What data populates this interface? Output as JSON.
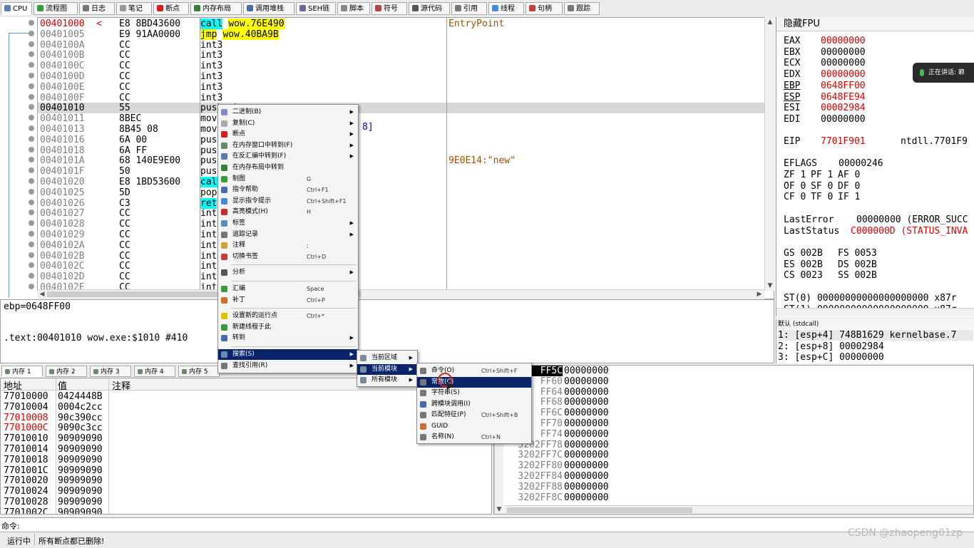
{
  "toolbar": {
    "tabs": [
      {
        "label": "CPU",
        "icon": "cpu-icon",
        "color": "#5a7fb5"
      },
      {
        "label": "流程图",
        "icon": "graph-icon",
        "color": "#3a9a3a"
      },
      {
        "label": "日志",
        "icon": "log-icon",
        "color": "#777777"
      },
      {
        "label": "笔记",
        "icon": "notes-icon",
        "color": "#999999"
      },
      {
        "label": "断点",
        "icon": "breakpoint-icon",
        "color": "#d02020"
      },
      {
        "label": "内存布局",
        "icon": "memory-map-icon",
        "color": "#3a7a3a"
      },
      {
        "label": "调用堆栈",
        "icon": "callstack-icon",
        "color": "#4a6aaa"
      },
      {
        "label": "SEH链",
        "icon": "seh-icon",
        "color": "#6a6a9a"
      },
      {
        "label": "脚本",
        "icon": "script-icon",
        "color": "#888888"
      },
      {
        "label": "符号",
        "icon": "symbol-icon",
        "color": "#b04a4a"
      },
      {
        "label": "源代码",
        "icon": "source-icon",
        "color": "#555555"
      },
      {
        "label": "引用",
        "icon": "references-icon",
        "color": "#777777"
      },
      {
        "label": "线程",
        "icon": "threads-icon",
        "color": "#4a8ad0"
      },
      {
        "label": "句柄",
        "icon": "handles-icon",
        "color": "#c04040"
      },
      {
        "label": "跟踪",
        "icon": "trace-icon",
        "color": "#777777"
      }
    ]
  },
  "disasm": {
    "rows": [
      {
        "addr": "00401000",
        "mark": "<",
        "bytes": "E8 8BD43600",
        "inst": "call",
        "operand": "wow.76E490",
        "comment": "EntryPoint",
        "style": "call",
        "addr_red": true
      },
      {
        "addr": "00401005",
        "mark": "",
        "bytes": "E9 91AA0000",
        "inst": "jmp",
        "operand": "wow.40BA9B",
        "comment": "",
        "style": "jmp"
      },
      {
        "addr": "0040100A",
        "bytes": "CC",
        "inst": "int3",
        "operand": "",
        "comment": ""
      },
      {
        "addr": "0040100B",
        "bytes": "CC",
        "inst": "int3",
        "operand": "",
        "comment": ""
      },
      {
        "addr": "0040100C",
        "bytes": "CC",
        "inst": "int3",
        "operand": "",
        "comment": ""
      },
      {
        "addr": "0040100D",
        "bytes": "CC",
        "inst": "int3",
        "operand": "",
        "comment": ""
      },
      {
        "addr": "0040100E",
        "bytes": "CC",
        "inst": "int3",
        "operand": "",
        "comment": ""
      },
      {
        "addr": "0040100F",
        "bytes": "CC",
        "inst": "int3",
        "operand": "",
        "comment": ""
      },
      {
        "addr": "00401010",
        "bytes": "55",
        "inst": "push ebp",
        "operand": "",
        "comment": "",
        "selected": true
      },
      {
        "addr": "00401011",
        "bytes": "8BEC",
        "inst": "mov",
        "operand": "",
        "comment": ""
      },
      {
        "addr": "00401013",
        "bytes": "8B45 08",
        "inst": "mov",
        "operand": "",
        "comment": ""
      },
      {
        "addr": "00401016",
        "bytes": "6A 00",
        "inst": "push",
        "operand": "",
        "comment": ""
      },
      {
        "addr": "00401018",
        "bytes": "6A FF",
        "inst": "push",
        "operand": "",
        "comment": ""
      },
      {
        "addr": "0040101A",
        "bytes": "68 140E9E00",
        "inst": "push",
        "operand": "",
        "comment": "9E0E14:\"new\""
      },
      {
        "addr": "0040101F",
        "bytes": "50",
        "inst": "push",
        "operand": "",
        "comment": ""
      },
      {
        "addr": "00401020",
        "bytes": "E8 1BD53600",
        "inst": "call",
        "operand": "",
        "comment": "",
        "style": "call"
      },
      {
        "addr": "00401025",
        "bytes": "5D",
        "inst": "pop",
        "operand": "",
        "comment": ""
      },
      {
        "addr": "00401026",
        "bytes": "C3",
        "inst": "ret",
        "operand": "",
        "comment": "",
        "style": "call"
      },
      {
        "addr": "00401027",
        "bytes": "CC",
        "inst": "int",
        "operand": "",
        "comment": ""
      },
      {
        "addr": "00401028",
        "bytes": "CC",
        "inst": "int",
        "operand": "",
        "comment": ""
      },
      {
        "addr": "00401029",
        "bytes": "CC",
        "inst": "int",
        "operand": "",
        "comment": ""
      },
      {
        "addr": "0040102A",
        "bytes": "CC",
        "inst": "int",
        "operand": "",
        "comment": ""
      },
      {
        "addr": "0040102B",
        "bytes": "CC",
        "inst": "int",
        "operand": "",
        "comment": ""
      },
      {
        "addr": "0040102C",
        "bytes": "CC",
        "inst": "int",
        "operand": "",
        "comment": ""
      },
      {
        "addr": "0040102D",
        "bytes": "CC",
        "inst": "int",
        "operand": "",
        "comment": ""
      },
      {
        "addr": "0040102E",
        "bytes": "CC",
        "inst": "int",
        "operand": "",
        "comment": ""
      }
    ],
    "partial_operand": "8]"
  },
  "info": {
    "line1": "ebp=0648FF00",
    "line2": ".text:00401010 wow.exe:$1010 #410"
  },
  "registers": {
    "title": "隐藏FPU",
    "gp": [
      {
        "name": "EAX",
        "value": "00000000",
        "red": true
      },
      {
        "name": "EBX",
        "value": "00000000",
        "red": false
      },
      {
        "name": "ECX",
        "value": "00000000",
        "red": false
      },
      {
        "name": "EDX",
        "value": "00000000",
        "red": true
      },
      {
        "name": "EBP",
        "value": "0648FF00",
        "red": true
      },
      {
        "name": "ESP",
        "value": "0648FE94",
        "red": true
      },
      {
        "name": "ESI",
        "value": "00002984",
        "red": true
      },
      {
        "name": "EDI",
        "value": "00000000",
        "red": false
      }
    ],
    "eip": {
      "name": "EIP",
      "value": "7701F901",
      "label": "ntdll.7701F9"
    },
    "eflags": {
      "name": "EFLAGS",
      "value": "00000246"
    },
    "flags": [
      [
        "ZF 1",
        "PF 1",
        "AF 0"
      ],
      [
        "OF 0",
        "SF 0",
        "DF 0"
      ],
      [
        "CF 0",
        "TF 0",
        "IF 1"
      ]
    ],
    "last_error": {
      "name": "LastError",
      "value": "00000000 (ERROR_SUCC"
    },
    "last_status": {
      "name": "LastStatus",
      "value": "C000000D (STATUS_INVA"
    },
    "segs": [
      [
        "GS 002B",
        "FS 0053"
      ],
      [
        "ES 002B",
        "DS 002B"
      ],
      [
        "CS 0023",
        "SS 002B"
      ]
    ],
    "st": [
      "ST(0) 00000000000000000000 x87r",
      "ST(1) 00000000000000000000 x87r"
    ]
  },
  "args": {
    "convention": "默认 (stdcall)",
    "rows": [
      "1: [esp+4] 748B1629 kernelbase.7",
      "2: [esp+8] 00002984",
      "3: [esp+C] 00000000"
    ]
  },
  "dump": {
    "tabs": [
      "内存 1",
      "内存 2",
      "内存 3",
      "内存 4",
      "内存 5"
    ],
    "headers": {
      "addr": "地址",
      "value": "值",
      "comment": "注释"
    },
    "rows": [
      {
        "addr": "77010000",
        "value": "0424448B",
        "red": false
      },
      {
        "addr": "77010004",
        "value": "0004c2cc",
        "red": false
      },
      {
        "addr": "77010008",
        "value": "90c390cc",
        "red": true
      },
      {
        "addr": "7701000C",
        "value": "9090c3cc",
        "red": true
      },
      {
        "addr": "77010010",
        "value": "90909090",
        "red": false
      },
      {
        "addr": "77010014",
        "value": "90909090",
        "red": false
      },
      {
        "addr": "77010018",
        "value": "90909090",
        "red": false
      },
      {
        "addr": "7701001C",
        "value": "90909090",
        "red": false
      },
      {
        "addr": "77010020",
        "value": "90909090",
        "red": false
      },
      {
        "addr": "77010024",
        "value": "90909090",
        "red": false
      },
      {
        "addr": "77010028",
        "value": "90909090",
        "red": false
      },
      {
        "addr": "7701002C",
        "value": "90909090",
        "red": false
      }
    ]
  },
  "stack": {
    "rows": [
      {
        "addr": "FF5C",
        "value": "00000000",
        "selected": true
      },
      {
        "addr": "FF60",
        "value": "00000000"
      },
      {
        "addr": "FF64",
        "value": "00000000"
      },
      {
        "addr": "FF68",
        "value": "00000000"
      },
      {
        "addr": "FF6C",
        "value": "00000000"
      },
      {
        "addr": "FF70",
        "value": "00000000"
      },
      {
        "addr": "FF74",
        "value": "00000000"
      },
      {
        "addr": "3202FF78",
        "value": "00000000"
      },
      {
        "addr": "3202FF7C",
        "value": "00000000"
      },
      {
        "addr": "3202FF80",
        "value": "00000000"
      },
      {
        "addr": "3202FF84",
        "value": "00000000"
      },
      {
        "addr": "3202FF88",
        "value": "00000000"
      },
      {
        "addr": "3202FF8C",
        "value": "00000000"
      }
    ]
  },
  "command": {
    "label": "命令:"
  },
  "status": {
    "state": "运行中",
    "message": "所有断点都已删除!"
  },
  "toast": {
    "text": "正在讲话: 赖"
  },
  "watermark": "CSDN @zhaopeng01zp",
  "menu_main": {
    "items": [
      {
        "label": "二进制(B)",
        "sc": "",
        "sub": true,
        "icon": "binary-icon",
        "color": "#8888cc"
      },
      {
        "label": "复制(C)",
        "sc": "",
        "sub": true,
        "icon": "copy-icon",
        "color": "#aaaaaa"
      },
      {
        "label": "断点",
        "sc": "",
        "sub": true,
        "icon": "breakpoint-icon",
        "color": "#d02020"
      },
      {
        "label": "在内存窗口中转到(F)",
        "sc": "",
        "sub": true,
        "icon": "memory-window-icon",
        "color": "#6a8a6a"
      },
      {
        "label": "在反汇编中转到(F)",
        "sc": "",
        "sub": true,
        "icon": "disasm-goto-icon",
        "color": "#5a7ab0"
      },
      {
        "label": "在内存布局中转到",
        "sc": "",
        "sub": false,
        "icon": "memory-map-icon",
        "color": "#3a7a3a"
      },
      {
        "label": "制图",
        "sc": "G",
        "sub": false,
        "icon": "graph-icon",
        "color": "#3a9a3a"
      },
      {
        "label": "指令帮助",
        "sc": "Ctrl+F1",
        "sub": false,
        "icon": "help-icon",
        "color": "#4a6ab0"
      },
      {
        "label": "显示指令提示",
        "sc": "Ctrl+Shift+F1",
        "sub": false,
        "icon": "hint-icon",
        "color": "#4a8ad0"
      },
      {
        "label": "高亮模式(H)",
        "sc": "H",
        "sub": false,
        "icon": "highlight-icon",
        "color": "#c03030"
      },
      {
        "label": "标签",
        "sc": "",
        "sub": true,
        "icon": "label-icon",
        "color": "#5a8ac0"
      },
      {
        "label": "追踪记录",
        "sc": "",
        "sub": true,
        "icon": "trace-record-icon",
        "color": "#777777"
      },
      {
        "label": "注释",
        "sc": ";",
        "sub": false,
        "icon": "comment-icon",
        "color": "#d0a040"
      },
      {
        "label": "切换书签",
        "sc": "Ctrl+D",
        "sub": false,
        "icon": "bookmark-icon",
        "color": "#c04040"
      },
      {
        "label": "分析",
        "sc": "",
        "sub": true,
        "icon": "analyze-icon",
        "color": "#555555",
        "sep_before": true
      },
      {
        "label": "汇编",
        "sc": "Space",
        "sub": false,
        "icon": "assemble-icon",
        "color": "#3a9a3a",
        "sep_before": true
      },
      {
        "label": "补丁",
        "sc": "Ctrl+P",
        "sub": false,
        "icon": "patch-icon",
        "color": "#d07030"
      },
      {
        "label": "设置新的运行点",
        "sc": "Ctrl+*",
        "sub": false,
        "icon": "set-origin-icon",
        "color": "#e0c000",
        "sep_before": true
      },
      {
        "label": "新建线程于此",
        "sc": "",
        "sub": false,
        "icon": "new-thread-icon",
        "color": "#3a9a3a"
      },
      {
        "label": "转到",
        "sc": "",
        "sub": true,
        "icon": "goto-icon",
        "color": "#4a6ab0"
      },
      {
        "label": "搜索(S)",
        "sc": "",
        "sub": true,
        "icon": "search-icon",
        "color": "#6a8ab0",
        "sep_before": true,
        "selected": true
      },
      {
        "label": "查找引用(R)",
        "sc": "",
        "sub": true,
        "icon": "find-refs-icon",
        "color": "#777777"
      }
    ]
  },
  "menu_search": {
    "items": [
      {
        "label": "当前区域",
        "sub": true,
        "icon": "region-icon"
      },
      {
        "label": "当前模块",
        "sub": true,
        "icon": "module-icon",
        "selected": true
      },
      {
        "label": "所有模块",
        "sub": true,
        "icon": "all-modules-icon"
      }
    ]
  },
  "menu_module": {
    "items": [
      {
        "label": "命令(O)",
        "sc": "Ctrl+Shift+F",
        "icon": "command-icon",
        "color": "#777777"
      },
      {
        "label": "常数(C)",
        "sc": "",
        "icon": "constant-icon",
        "color": "#777777",
        "selected": true
      },
      {
        "label": "字符串(S)",
        "sc": "",
        "icon": "string-icon",
        "color": "#777777"
      },
      {
        "label": "跨模块调用(I)",
        "sc": "",
        "icon": "intermodular-icon",
        "color": "#4a6ab0"
      },
      {
        "label": "匹配特征(P)",
        "sc": "Ctrl+Shift+B",
        "icon": "pattern-icon",
        "color": "#777777"
      },
      {
        "label": "GUID",
        "sc": "",
        "icon": "guid-icon",
        "color": "#d07030"
      },
      {
        "label": "名称(N)",
        "sc": "Ctrl+N",
        "icon": "names-icon",
        "color": "#777777"
      }
    ]
  }
}
